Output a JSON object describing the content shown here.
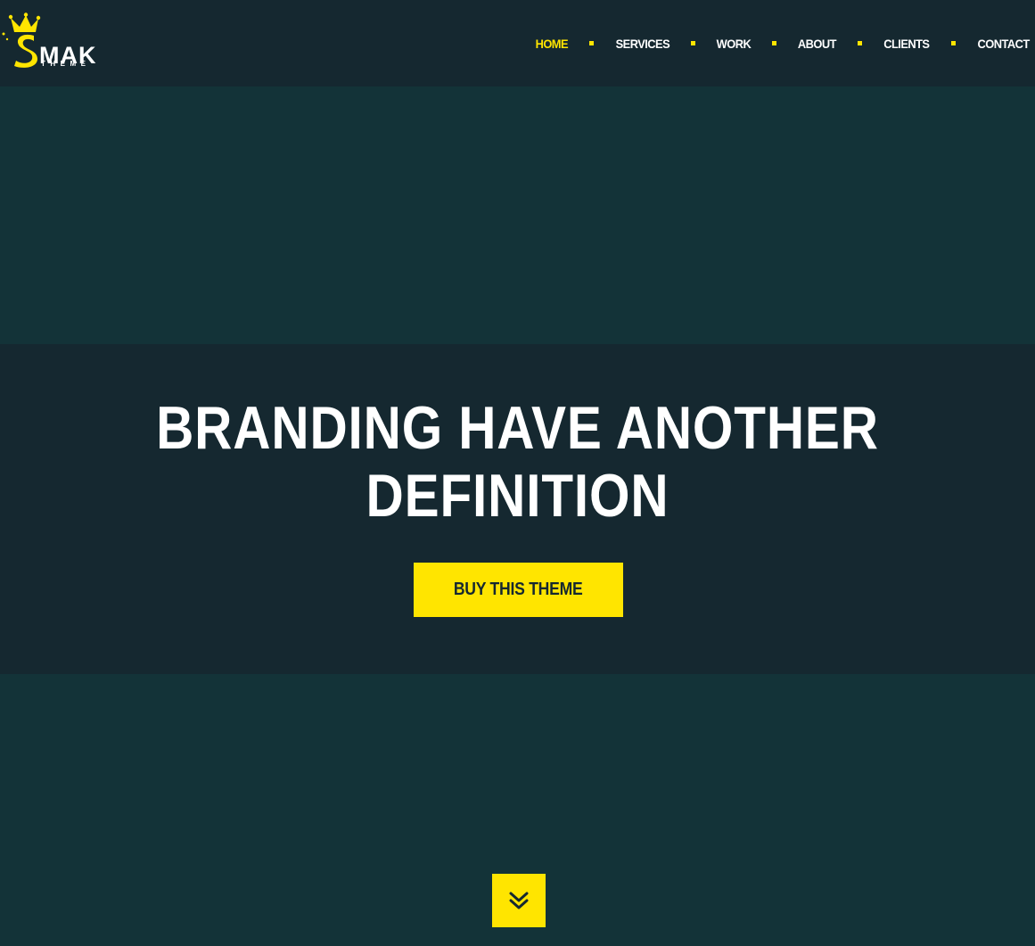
{
  "brand": {
    "name": "SMAK",
    "sub": "THEME",
    "accent": "#ffe500"
  },
  "nav": {
    "items": [
      {
        "label": "HOME",
        "active": true
      },
      {
        "label": "SERVICES",
        "active": false
      },
      {
        "label": "WORK",
        "active": false
      },
      {
        "label": "ABOUT",
        "active": false
      },
      {
        "label": "CLIENTS",
        "active": false
      },
      {
        "label": "CONTACT",
        "active": false
      }
    ]
  },
  "hero": {
    "title_line1": "BRANDING HAVE ANOTHER",
    "title_line2": "DEFINITION",
    "cta_label": "BUY THIS THEME"
  },
  "scroll": {
    "icon": "double-chevron-down-icon"
  },
  "colors": {
    "header_bg": "#152830",
    "page_bg": "#133338",
    "accent": "#ffe500",
    "text": "#ffffff"
  }
}
